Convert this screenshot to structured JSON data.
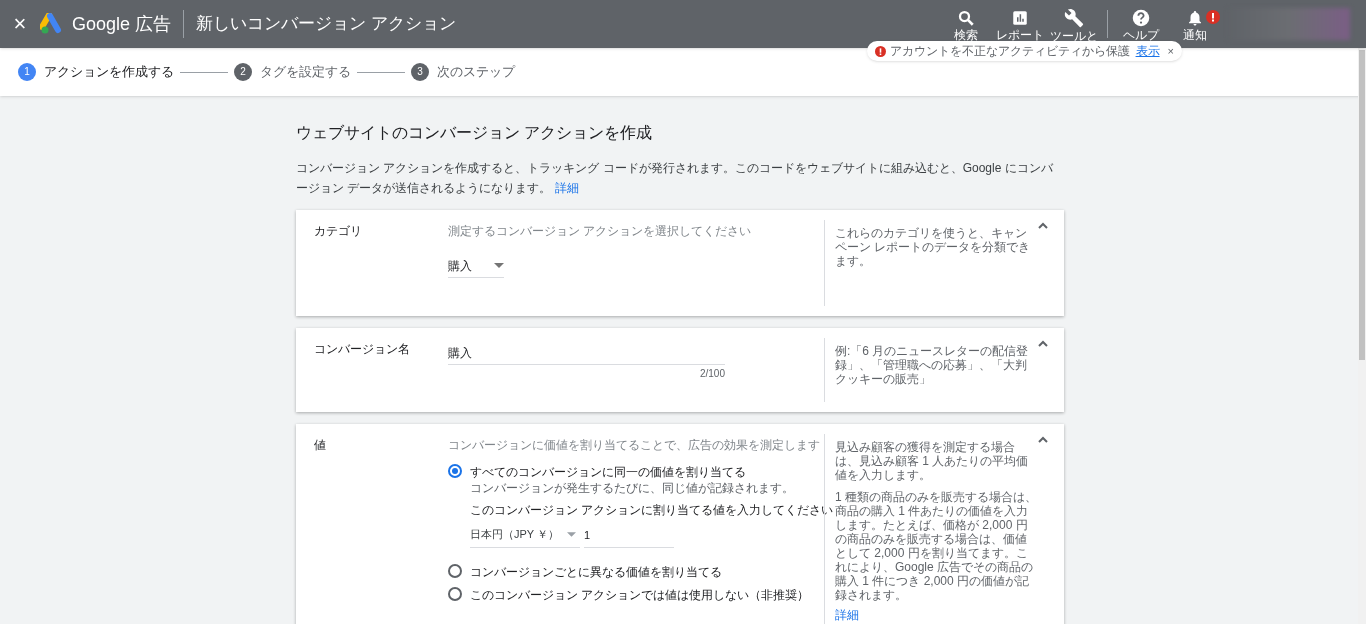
{
  "header": {
    "close_icon": "×",
    "product": "Google 広告",
    "title": "新しいコンバージョン アクション",
    "tools": [
      {
        "kind": "search",
        "label": "検索"
      },
      {
        "kind": "reports",
        "label": "レポート"
      },
      {
        "kind": "tools",
        "label": "ツールと"
      },
      {
        "kind": "help",
        "label": "ヘルプ"
      },
      {
        "kind": "notifications",
        "label": "通知",
        "alert": true
      }
    ]
  },
  "security_banner": {
    "text": "アカウントを不正なアクティビティから保護",
    "link": "表示",
    "close": "×"
  },
  "steps": [
    {
      "number": "1",
      "label": "アクションを作成する",
      "selected": true
    },
    {
      "number": "2",
      "label": "タグを設定する",
      "selected": false
    },
    {
      "number": "3",
      "label": "次のステップ",
      "selected": false
    }
  ],
  "page": {
    "title": "ウェブサイトのコンバージョン アクションを作成",
    "description": "コンバージョン アクションを作成すると、トラッキング コードが発行されます。このコードをウェブサイトに組み込むと、Google にコンバージョン データが送信されるようになります。",
    "description_link": "詳細"
  },
  "sections": [
    {
      "kind": "category",
      "label": "カテゴリ",
      "prompt": "測定するコンバージョン アクションを選択してください",
      "value": "購入",
      "help": [
        "これらのカテゴリを使うと、キャンペーン レポートのデータを分類できます。"
      ],
      "expanded": true
    },
    {
      "kind": "name",
      "label": "コンバージョン名",
      "value": "購入",
      "counter": "2/100",
      "help": [
        "例:「6 月のニュースレターの配信登録」、「管理職への応募」、「大判クッキーの販売」"
      ],
      "expanded": true
    },
    {
      "kind": "value",
      "label": "値",
      "prompt": "コンバージョンに価値を割り当てることで、広告の効果を測定します",
      "options": [
        {
          "label": "すべてのコンバージョンに同一の価値を割り当てる",
          "hint": "コンバージョンが発生するたびに、同じ値が記録されます。",
          "selected": true,
          "amount_label": "このコンバージョン アクションに割り当てる値を入力してください",
          "currency": "日本円（JPY ￥）",
          "amount": "1"
        },
        {
          "label": "コンバージョンごとに異なる価値を割り当てる",
          "selected": false
        },
        {
          "label": "このコンバージョン アクションでは値は使用しない（非推奨）",
          "selected": false
        }
      ],
      "help": [
        "見込み顧客の獲得を測定する場合は、見込み顧客 1 人あたりの平均価値を入力します。",
        "1 種類の商品のみを販売する場合は、商品の購入 1 件あたりの価値を入力します。たとえば、価格が 2,000 円の商品のみを販売する場合は、価値として 2,000 円を割り当てます。これにより、Google 広告でその商品の購入 1 件につき 2,000 円の価値が記録されます。"
      ],
      "help_link": "詳細",
      "expanded": true
    }
  ]
}
